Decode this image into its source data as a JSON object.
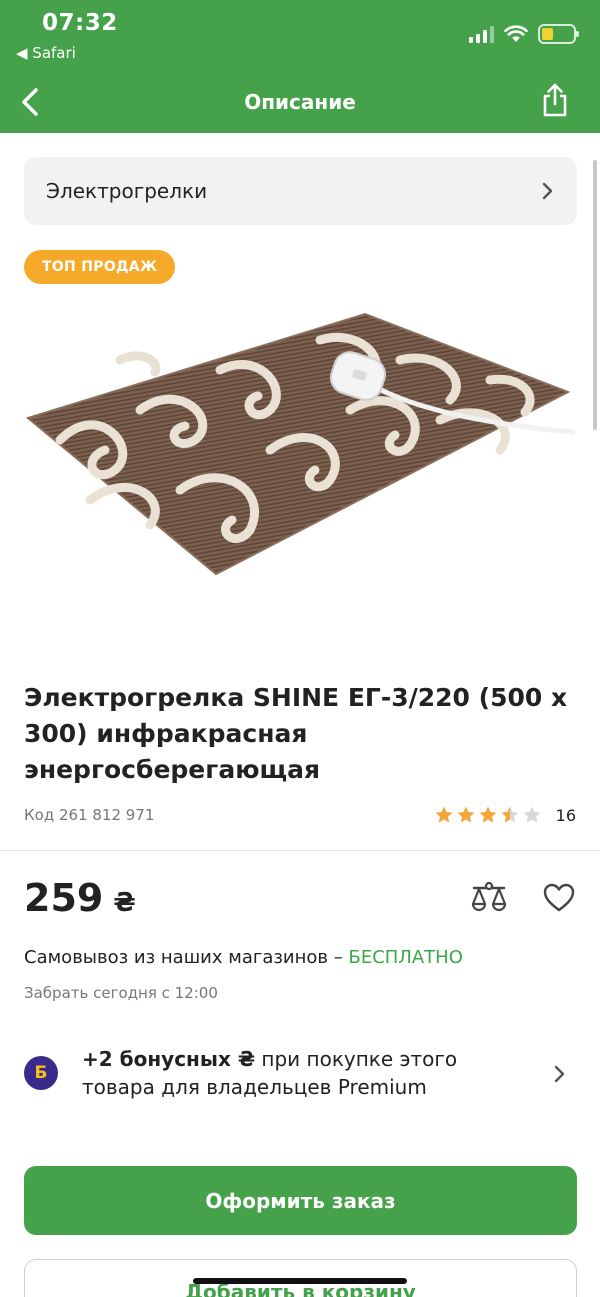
{
  "status": {
    "time": "07:32",
    "back_app": "◀ Safari"
  },
  "header": {
    "title": "Описание",
    "back_icon": "chevron-left-icon",
    "share_icon": "share-icon"
  },
  "breadcrumb": {
    "label": "Электрогрелки"
  },
  "badge": {
    "label": "ТОП ПРОДАЖ"
  },
  "product": {
    "title": "Электрогрелка SHINE ЕГ-3/220 (500 х 300) инфракрасная энергосберегающая",
    "code": "Код 261 812 971",
    "rating_value": 3.5,
    "rating_max": 5,
    "rating_count": "16",
    "price": "259",
    "currency": "₴"
  },
  "delivery": {
    "pickup_label": "Самовывоз из наших магазинов –",
    "pickup_free": "БЕСПЛАТНО",
    "pickup_time": "Забрать сегодня с 12:00"
  },
  "bonus": {
    "icon_letter": "Б",
    "bold_text": "+2 бонусных ₴",
    "rest_text": " при покупке этого товара для владельцев Premium"
  },
  "buttons": {
    "order": "Оформить заказ",
    "cart": "Добавить в корзину"
  },
  "colors": {
    "brand_green": "#45a24a",
    "badge_orange": "#f5a929",
    "star": "#f3a73a",
    "free_text": "#3aa845"
  }
}
